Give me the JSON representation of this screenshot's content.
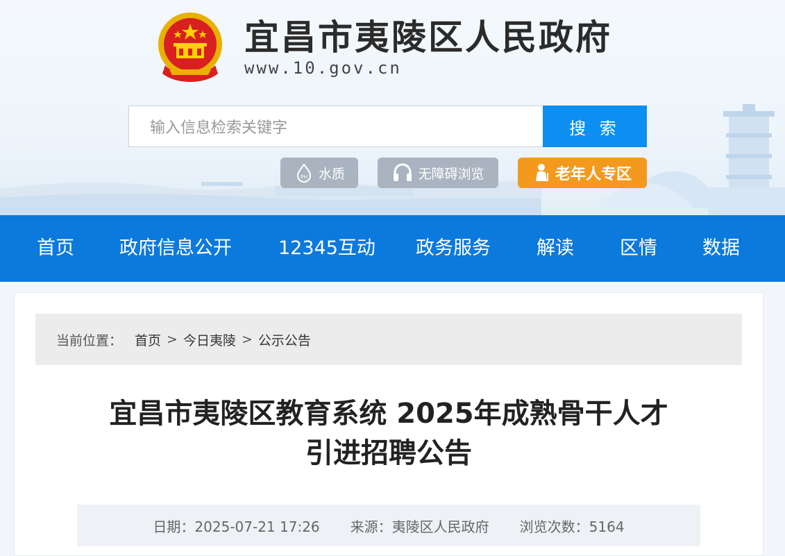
{
  "header": {
    "site_title": "宜昌市夷陵区人民政府",
    "site_url": "www.10.gov.cn"
  },
  "search": {
    "placeholder": "输入信息检索关键字",
    "button_label": "搜 索"
  },
  "quick_links": {
    "water": "水质",
    "accessibility": "无障碍浏览",
    "elderly": "老年人专区"
  },
  "nav": {
    "items": [
      "首页",
      "政府信息公开",
      "12345互动",
      "政务服务",
      "解读",
      "区情",
      "数据"
    ]
  },
  "breadcrumb": {
    "label": "当前位置：",
    "items": [
      "首页",
      "今日夷陵",
      "公示公告"
    ],
    "separator": ">"
  },
  "article": {
    "title_line1": "宜昌市夷陵区教育系统 2025年成熟骨干人才",
    "title_line2": "引进招聘公告",
    "date": "日期：2025-07-21 17:26",
    "source": "来源：夷陵区人民政府",
    "views": "浏览次数：5164"
  },
  "colors": {
    "nav_blue": "#0c79dc",
    "search_blue": "#0c8ff0",
    "elder_orange": "#f39a1e",
    "pill_gray": "#a9b4c0"
  }
}
